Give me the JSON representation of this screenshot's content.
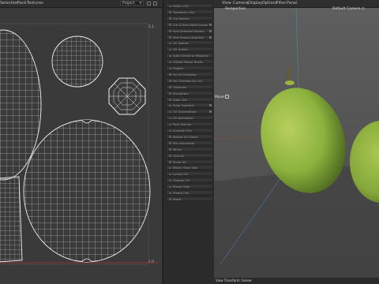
{
  "menubar": {
    "items": [
      "Selection",
      "Pack",
      "Textures"
    ],
    "dropdown": "Project",
    "dropdown_arrow": "▾"
  },
  "uv_editor": {
    "corner_top": "1,1",
    "corner_bottom": "1,0"
  },
  "tools": [
    {
      "label": "Select UVs",
      "toggle": false
    },
    {
      "label": "Transform UVs",
      "toggle": false
    },
    {
      "label": "Cut Seams",
      "toggle": false
    },
    {
      "label": "Cut & Sew Along Loops",
      "toggle": true
    },
    {
      "label": "Sew Selected Seams",
      "toggle": true
    },
    {
      "label": "Sew Seams Shortest",
      "toggle": true
    },
    {
      "label": "UV Islands",
      "toggle": false
    },
    {
      "label": "UV Unfold",
      "toggle": false
    },
    {
      "label": "Auto Unfold w/ Mapping",
      "toggle": false
    },
    {
      "label": "Unfold Planar Shells",
      "toggle": false
    },
    {
      "label": "Flatten",
      "toggle": false
    },
    {
      "label": "Fix UV Overlaps",
      "toggle": false
    },
    {
      "label": "Fix Overlaps by Cut",
      "toggle": false
    },
    {
      "label": "Optimize",
      "toggle": false
    },
    {
      "label": "Straighten",
      "toggle": false
    },
    {
      "label": "Align UVs",
      "toggle": false
    },
    {
      "label": "Snap Together",
      "toggle": true
    },
    {
      "label": "UV Symmetrize",
      "toggle": true
    },
    {
      "label": "UV Normalize",
      "toggle": false
    },
    {
      "label": "Pack Islands",
      "toggle": false
    },
    {
      "label": "Arrange UVs",
      "toggle": false
    },
    {
      "label": "Rotate UV Shells",
      "toggle": false
    },
    {
      "label": "Flip Horizontal",
      "toggle": false
    },
    {
      "label": "Mirror",
      "toggle": false
    },
    {
      "label": "Grid UV",
      "toggle": false
    },
    {
      "label": "Scale UV",
      "toggle": false
    },
    {
      "label": "Match Texel Size",
      "toggle": false
    },
    {
      "label": "Layout UV",
      "toggle": false
    },
    {
      "label": "Unwrap UV",
      "toggle": false
    },
    {
      "label": "Planar Map",
      "toggle": false
    },
    {
      "label": "Frame UVs",
      "toggle": false
    },
    {
      "label": "Reset",
      "toggle": false
    }
  ],
  "viewport": {
    "menu": [
      "View",
      "Camera",
      "Display",
      "Options",
      "Filter",
      "Panel"
    ],
    "perspective_label": "Perspective",
    "camera_label": "Default Camera ◷",
    "axis_label": "Move",
    "status": "View Transform: Scene"
  },
  "colors": {
    "fruit": "#8db23e",
    "uv_lines": "#e8e8e8"
  }
}
